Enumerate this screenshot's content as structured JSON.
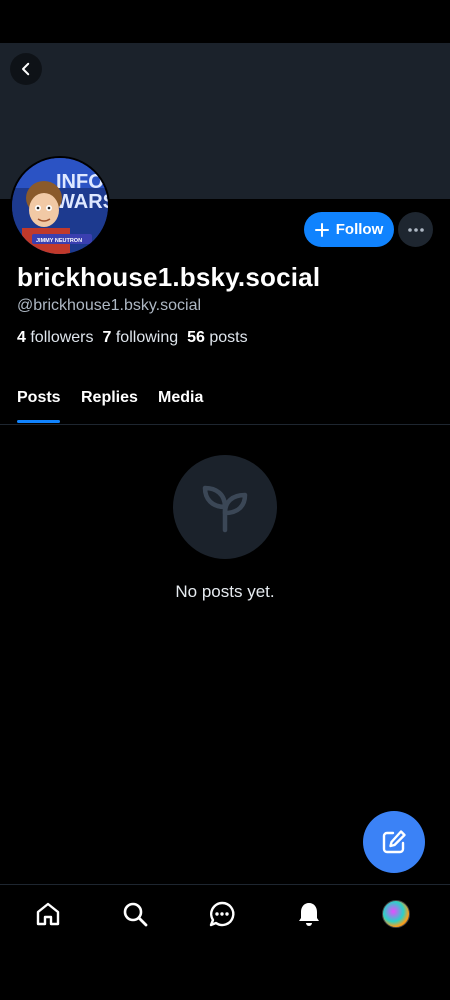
{
  "profile": {
    "display_name": "brickhouse1.bsky.social",
    "handle": "@brickhouse1.bsky.social",
    "followers_count": "4",
    "followers_label": "followers",
    "following_count": "7",
    "following_label": "following",
    "posts_count": "56",
    "posts_label": "posts",
    "avatar_text_top": "INFO",
    "avatar_text_mid": "WARS",
    "avatar_caption": "JIMMY NEUTRON"
  },
  "actions": {
    "follow_label": "Follow",
    "back_icon": "chevron-left-icon",
    "more_icon": "ellipsis-icon",
    "compose_icon": "compose-icon"
  },
  "tabs": [
    {
      "label": "Posts",
      "active": true
    },
    {
      "label": "Replies",
      "active": false
    },
    {
      "label": "Media",
      "active": false
    }
  ],
  "feed": {
    "empty_text": "No posts yet.",
    "empty_icon": "seedling-icon"
  },
  "nav": [
    {
      "icon": "home-icon"
    },
    {
      "icon": "search-icon"
    },
    {
      "icon": "chat-icon"
    },
    {
      "icon": "bell-icon"
    },
    {
      "icon": "profile-avatar"
    }
  ],
  "colors": {
    "accent": "#1083fe",
    "fab": "#3b82f6",
    "background": "#000000",
    "banner": "#1b222b"
  }
}
